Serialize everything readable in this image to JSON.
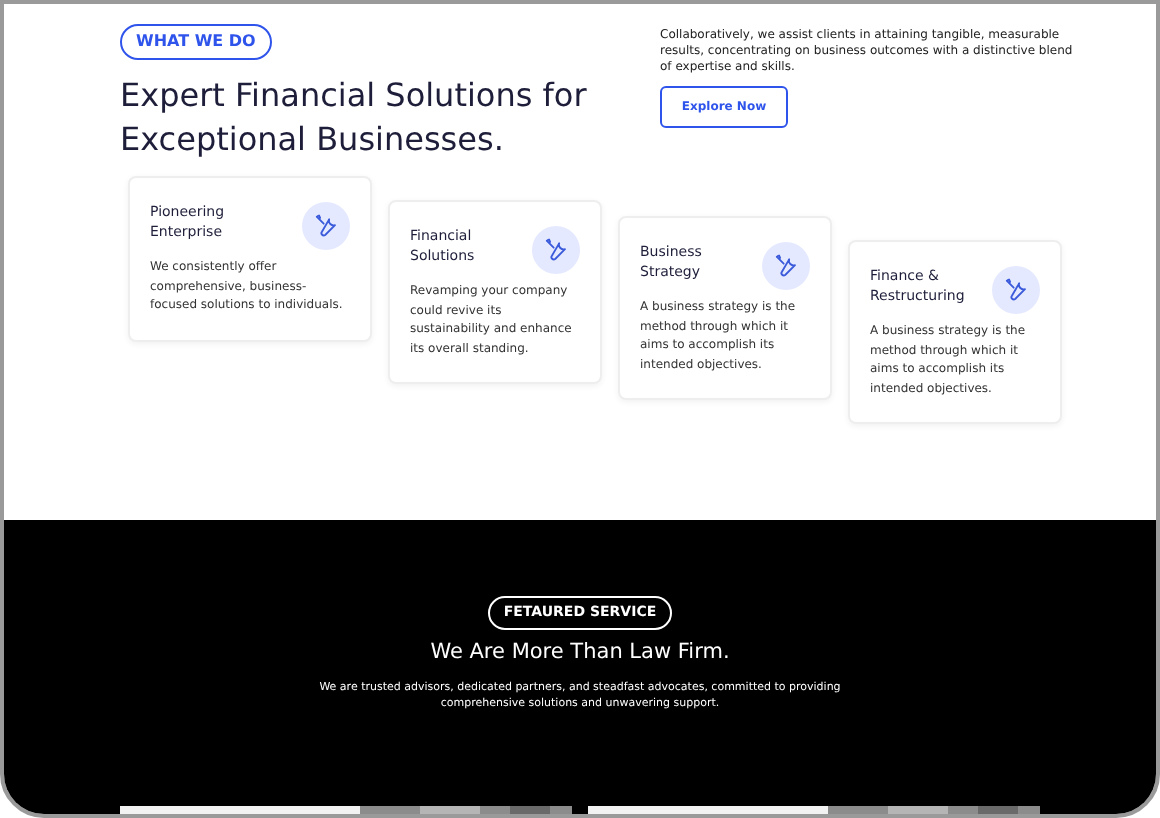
{
  "intro": {
    "badge": "WHAT WE DO",
    "heading": "Expert Financial Solutions for Exceptional Businesses.",
    "description": "Collaboratively, we assist clients in attaining tangible, measurable results, concentrating on business outcomes with a distinctive blend of expertise and skills.",
    "button": "Explore Now"
  },
  "services": [
    {
      "title": "Pioneering Enterprise",
      "text": "We consistently offer comprehensive, business-focused solutions to individuals."
    },
    {
      "title": "Financial Solutions",
      "text": "Revamping your company could revive its sustainability and enhance its overall standing."
    },
    {
      "title": "Business Strategy",
      "text": "A business strategy is the method through which it aims to accomplish its intended objectives."
    },
    {
      "title": "Finance & Restructuring",
      "text": "A business strategy is the method through which it aims to accomplish its intended objectives."
    }
  ],
  "featured": {
    "badge": "FETAURED SERVICE",
    "heading": "We Are More Than Law Firm.",
    "text": "We are trusted advisors, dedicated partners, and steadfast advocates, committed to providing comprehensive solutions and unwavering support."
  }
}
